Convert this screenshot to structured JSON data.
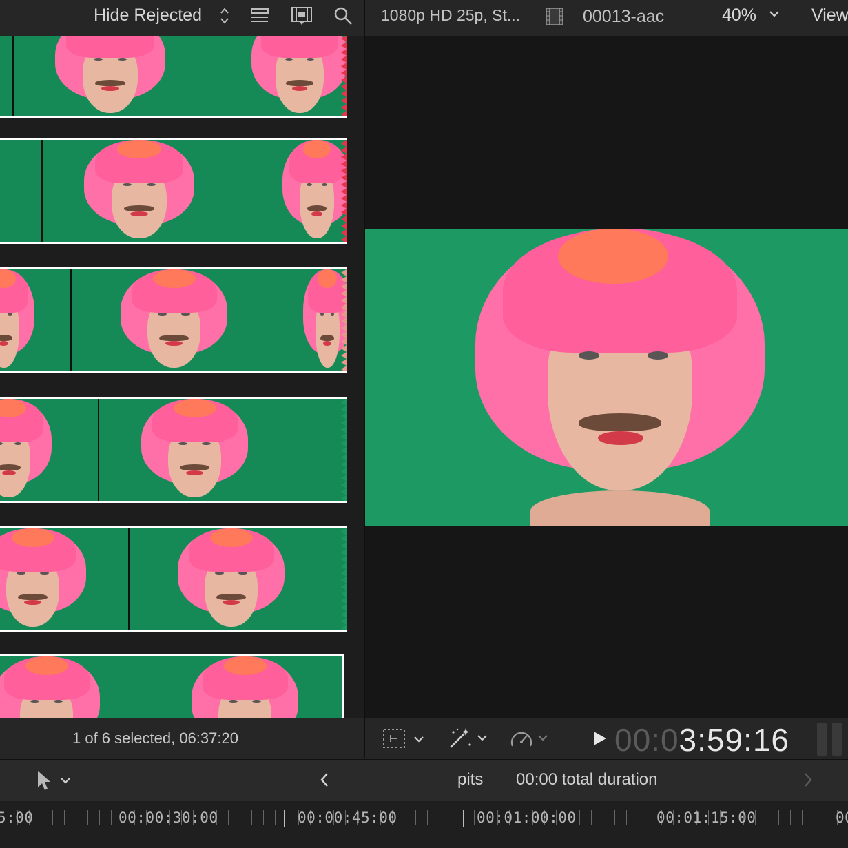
{
  "browser_toolbar": {
    "filter_label": "Hide Rejected"
  },
  "viewer_toolbar": {
    "format_label": "1080p HD 25p, St...",
    "clip_name": "00013-aac",
    "zoom_label": "40%",
    "view_label": "View"
  },
  "browser_status": {
    "selection_text": "1 of 6 selected, 06:37:20"
  },
  "viewer_status": {
    "timecode_dim": "00:0",
    "timecode_bright": "3:59:16"
  },
  "timeline_toolbar": {
    "project_name": "pits",
    "duration_text": "00:00 total duration"
  },
  "ruler": {
    "labels": [
      "5:00",
      "00:00:30:00",
      "00:00:45:00",
      "00:01:00:00",
      "00:01:15:00",
      "00"
    ]
  },
  "icons": {
    "filter": "updown-chevron-icon",
    "clip_appearance": "list-icon",
    "filmstrip": "filmstrip-icon",
    "search": "search-icon",
    "format_film": "film-icon",
    "zoom_chevron": "chevron-down-icon",
    "transform": "transform-icon",
    "enhance": "magic-wand-icon",
    "retime": "speedometer-icon",
    "play": "play-icon",
    "select_tool": "arrow-cursor-icon",
    "back": "chevron-left-icon",
    "forward": "chevron-right-icon"
  },
  "colors": {
    "greenscreen": "#1d9a63",
    "wig": "#ff6fa8",
    "selection_border": "#ffffff"
  }
}
